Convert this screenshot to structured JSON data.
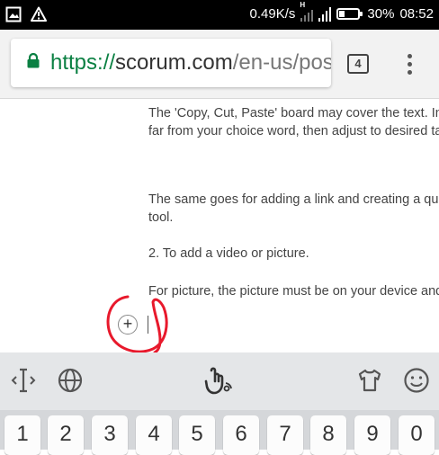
{
  "status_bar": {
    "network_speed": "0.49K/s",
    "network_type": "H",
    "battery_percent": "30%",
    "battery_level": 0.3,
    "time": "08:52"
  },
  "browser": {
    "url_scheme": "https://",
    "url_host": "scorum.com",
    "url_path": "/en-us/pos",
    "tab_count": "4"
  },
  "content": {
    "paragraph_1_line_1": "The 'Copy, Cut, Paste' board may cover the text. In this",
    "paragraph_1_line_2": "far from your choice word, then adjust to desired taste",
    "paragraph_2_line_1": "The same goes for adding a link and creating a quote.",
    "paragraph_2_line_2": "tool.",
    "heading_2": "2. To add a video or picture.",
    "paragraph_3_line_1": "For picture, the picture must be on your device and it s",
    "plus_glyph": "+"
  },
  "keyboard": {
    "number_keys": [
      "1",
      "2",
      "3",
      "4",
      "5",
      "6",
      "7",
      "8",
      "9",
      "0"
    ],
    "toolbar_icons": [
      "cursor-icon",
      "globe-icon",
      "voice-touch-icon",
      "theme-shirt-icon",
      "emoji-icon"
    ]
  },
  "colors": {
    "secure_green": "#0b8043",
    "annotation_red": "#e8192c"
  }
}
